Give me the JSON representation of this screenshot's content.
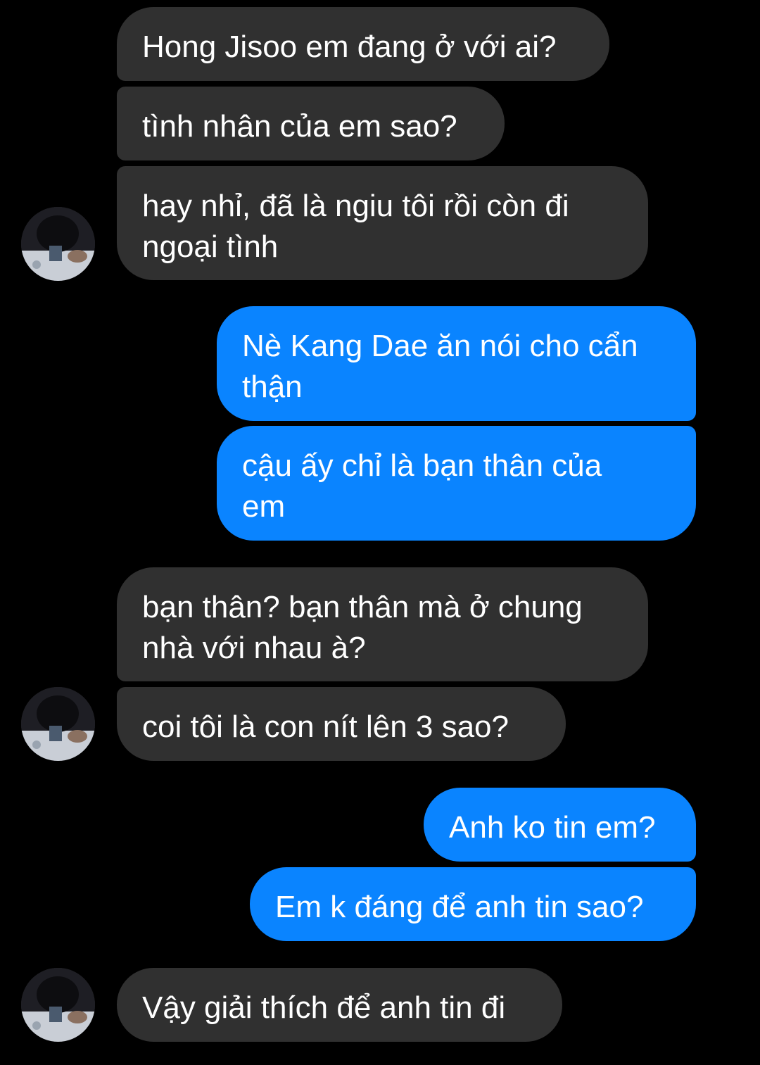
{
  "conversation": {
    "messages": [
      {
        "sender": "contact",
        "text": "Hong Jisoo em đang ở với ai?"
      },
      {
        "sender": "contact",
        "text": "tình nhân của em sao?"
      },
      {
        "sender": "contact",
        "text": "hay nhỉ, đã là ngiu tôi rồi còn đi\nngoại tình"
      },
      {
        "sender": "me",
        "text": "Nè Kang Dae ăn nói cho cẩn\nthận"
      },
      {
        "sender": "me",
        "text": "cậu ấy chỉ là bạn thân của\nem"
      },
      {
        "sender": "contact",
        "text": "bạn thân? bạn thân mà ở chung\nnhà với nhau à?"
      },
      {
        "sender": "contact",
        "text": "coi tôi là con nít lên 3 sao?"
      },
      {
        "sender": "me",
        "text": "Anh ko tin em?"
      },
      {
        "sender": "me",
        "text": "Em k đáng để anh tin sao?"
      },
      {
        "sender": "contact",
        "text": "Vậy giải thích để anh tin đi"
      }
    ]
  },
  "colors": {
    "background": "#000000",
    "incoming_bubble": "#303030",
    "outgoing_bubble": "#0a84ff",
    "text": "#ffffff"
  },
  "icons": {
    "avatar": "contact-avatar-photo"
  }
}
